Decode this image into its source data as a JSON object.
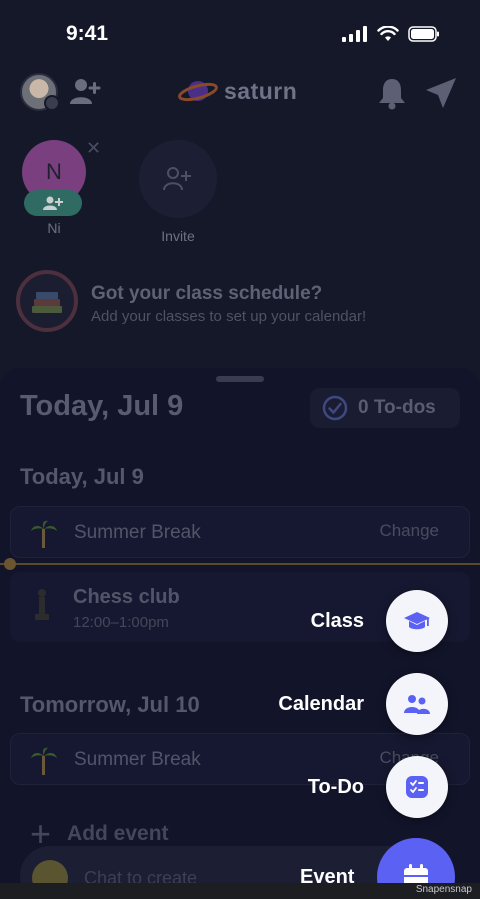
{
  "status_bar": {
    "time": "9:41"
  },
  "header": {
    "logo_text": "saturn"
  },
  "friends": [
    {
      "initial": "N",
      "label": "Ni"
    },
    {
      "label": "Invite"
    }
  ],
  "schedule_prompt": {
    "title": "Got your class schedule?",
    "subtitle": "Add your classes to set up your calendar!"
  },
  "sheet": {
    "title": "Today, Jul 9",
    "todo_label": "0 To-dos",
    "days": [
      {
        "heading": "Today, Jul 9",
        "events": [
          {
            "title": "Summer Break",
            "action": "Change"
          },
          {
            "title": "Chess club",
            "time": "12:00–1:00pm"
          }
        ]
      },
      {
        "heading": "Tomorrow, Jul 10",
        "events": [
          {
            "title": "Summer Break",
            "action": "Change"
          }
        ]
      }
    ],
    "add_event_label": "Add event",
    "chat_placeholder": "Chat to create"
  },
  "fab_menu": {
    "items": [
      {
        "label": "Class",
        "icon": "graduation-cap-icon"
      },
      {
        "label": "Calendar",
        "icon": "people-icon"
      },
      {
        "label": "To-Do",
        "icon": "checklist-icon"
      },
      {
        "label": "Event",
        "icon": "calendar-icon"
      }
    ]
  },
  "footer": {
    "watermark": "Snapensnap"
  },
  "colors": {
    "accent": "#5b61f3",
    "background": "#151829"
  }
}
